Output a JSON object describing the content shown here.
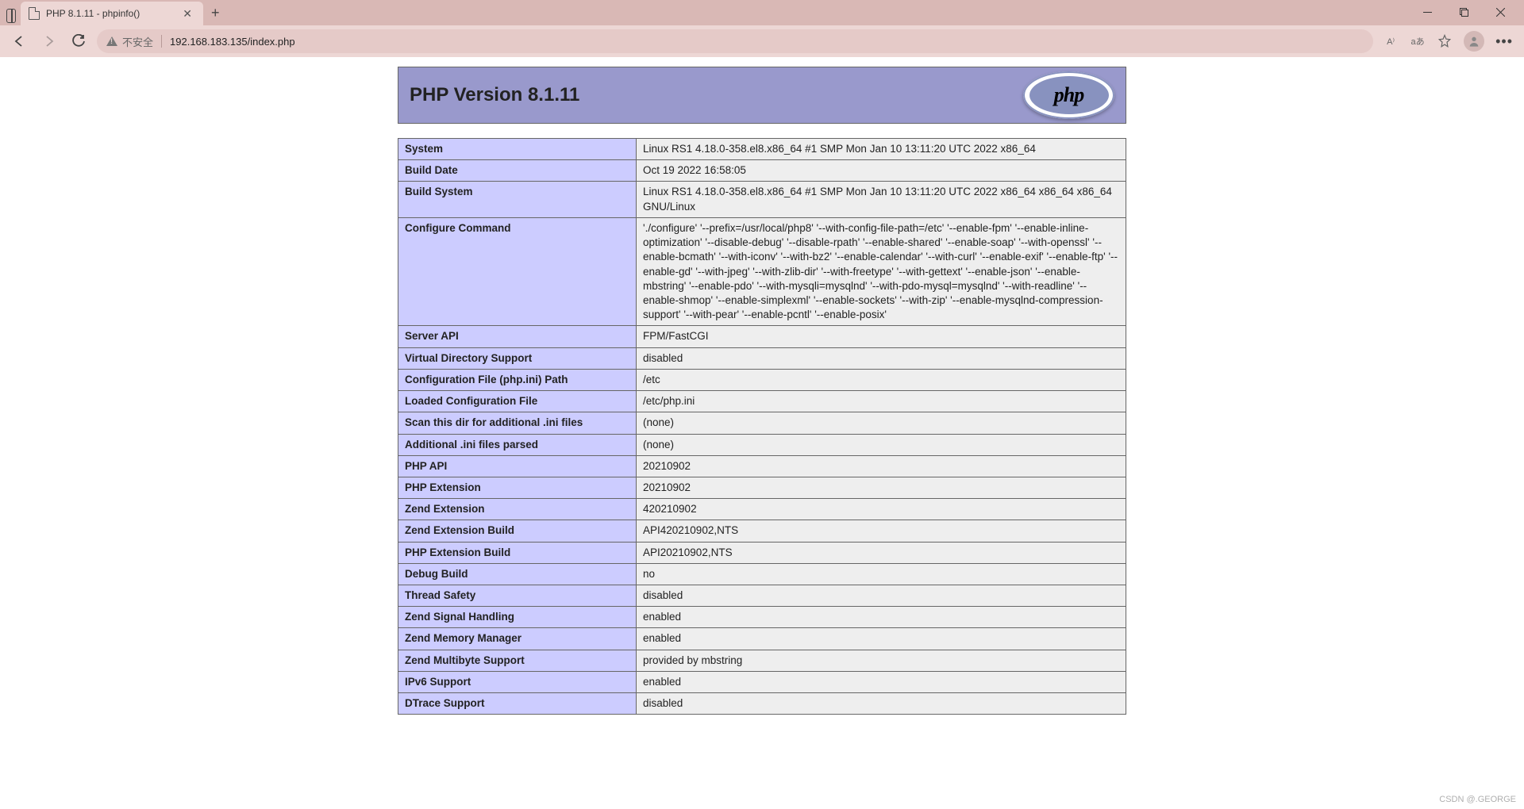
{
  "browser": {
    "tab_title": "PHP 8.1.11 - phpinfo()",
    "insecure_label": "不安全",
    "url": "192.168.183.135/index.php",
    "read_aloud": "A⁾",
    "translate": "aあ"
  },
  "page": {
    "header_title": "PHP Version 8.1.11",
    "logo_text": "php"
  },
  "rows": [
    {
      "k": "System",
      "v": "Linux RS1 4.18.0-358.el8.x86_64 #1 SMP Mon Jan 10 13:11:20 UTC 2022 x86_64"
    },
    {
      "k": "Build Date",
      "v": "Oct 19 2022 16:58:05"
    },
    {
      "k": "Build System",
      "v": "Linux RS1 4.18.0-358.el8.x86_64 #1 SMP Mon Jan 10 13:11:20 UTC 2022 x86_64 x86_64 x86_64 GNU/Linux"
    },
    {
      "k": "Configure Command",
      "v": "'./configure' '--prefix=/usr/local/php8' '--with-config-file-path=/etc' '--enable-fpm' '--enable-inline-optimization' '--disable-debug' '--disable-rpath' '--enable-shared' '--enable-soap' '--with-openssl' '--enable-bcmath' '--with-iconv' '--with-bz2' '--enable-calendar' '--with-curl' '--enable-exif' '--enable-ftp' '--enable-gd' '--with-jpeg' '--with-zlib-dir' '--with-freetype' '--with-gettext' '--enable-json' '--enable-mbstring' '--enable-pdo' '--with-mysqli=mysqlnd' '--with-pdo-mysql=mysqlnd' '--with-readline' '--enable-shmop' '--enable-simplexml' '--enable-sockets' '--with-zip' '--enable-mysqlnd-compression-support' '--with-pear' '--enable-pcntl' '--enable-posix'"
    },
    {
      "k": "Server API",
      "v": "FPM/FastCGI"
    },
    {
      "k": "Virtual Directory Support",
      "v": "disabled"
    },
    {
      "k": "Configuration File (php.ini) Path",
      "v": "/etc"
    },
    {
      "k": "Loaded Configuration File",
      "v": "/etc/php.ini"
    },
    {
      "k": "Scan this dir for additional .ini files",
      "v": "(none)"
    },
    {
      "k": "Additional .ini files parsed",
      "v": "(none)"
    },
    {
      "k": "PHP API",
      "v": "20210902"
    },
    {
      "k": "PHP Extension",
      "v": "20210902"
    },
    {
      "k": "Zend Extension",
      "v": "420210902"
    },
    {
      "k": "Zend Extension Build",
      "v": "API420210902,NTS"
    },
    {
      "k": "PHP Extension Build",
      "v": "API20210902,NTS"
    },
    {
      "k": "Debug Build",
      "v": "no"
    },
    {
      "k": "Thread Safety",
      "v": "disabled"
    },
    {
      "k": "Zend Signal Handling",
      "v": "enabled"
    },
    {
      "k": "Zend Memory Manager",
      "v": "enabled"
    },
    {
      "k": "Zend Multibyte Support",
      "v": "provided by mbstring"
    },
    {
      "k": "IPv6 Support",
      "v": "enabled"
    },
    {
      "k": "DTrace Support",
      "v": "disabled"
    }
  ],
  "watermark": "CSDN @.GEORGE"
}
